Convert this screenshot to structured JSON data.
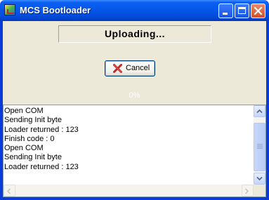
{
  "window": {
    "title": "MCS Bootloader",
    "controls": [
      "minimize-icon",
      "maximize-icon",
      "close-icon"
    ]
  },
  "status": {
    "message": "Uploading...",
    "percent_text": "0%",
    "progress": 0
  },
  "buttons": {
    "cancel_label": "Cancel",
    "cancel_icon": "red-x-icon"
  },
  "log": {
    "lines": [
      "Open COM",
      "Sending Init byte",
      "Loader returned : 123",
      "Finish code : 0",
      "Open COM",
      "Sending Init byte",
      "Loader returned : 123"
    ]
  },
  "colors": {
    "titlebar": "#0556e8",
    "dialog_bg": "#ece9d8",
    "close_button": "#d24f2a",
    "cancel_x": "#c0282a"
  }
}
